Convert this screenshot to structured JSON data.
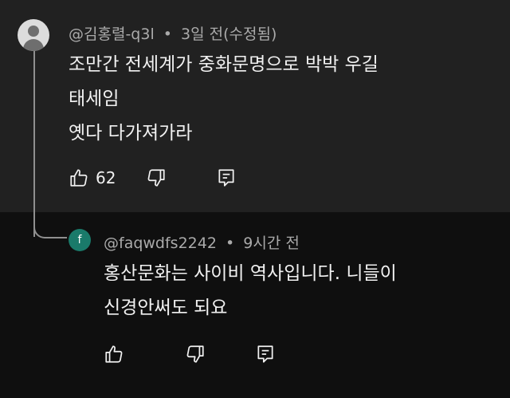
{
  "comment": {
    "author": "@김홍렬-q3l",
    "separator": "•",
    "time": "3일 전(수정됨)",
    "lines": [
      "조만간 전세계가 중화문명으로 박박 우길",
      "태세임",
      "옛다 다가져가라"
    ],
    "likes": "62"
  },
  "reply": {
    "avatar_letter": "f",
    "author": "@faqwdfs2242",
    "separator": "•",
    "time": "9시간 전",
    "lines": [
      "홍산문화는 사이비 역사입니다. 니들이",
      "신경안써도 되요"
    ]
  },
  "colors": {
    "top_bg": "#212121",
    "bottom_bg": "#0f0f0f",
    "reply_avatar": "#1a7a6a"
  },
  "icons": {
    "like": "thumbs-up-icon",
    "dislike": "thumbs-down-icon",
    "reply": "reply-comment-icon"
  }
}
